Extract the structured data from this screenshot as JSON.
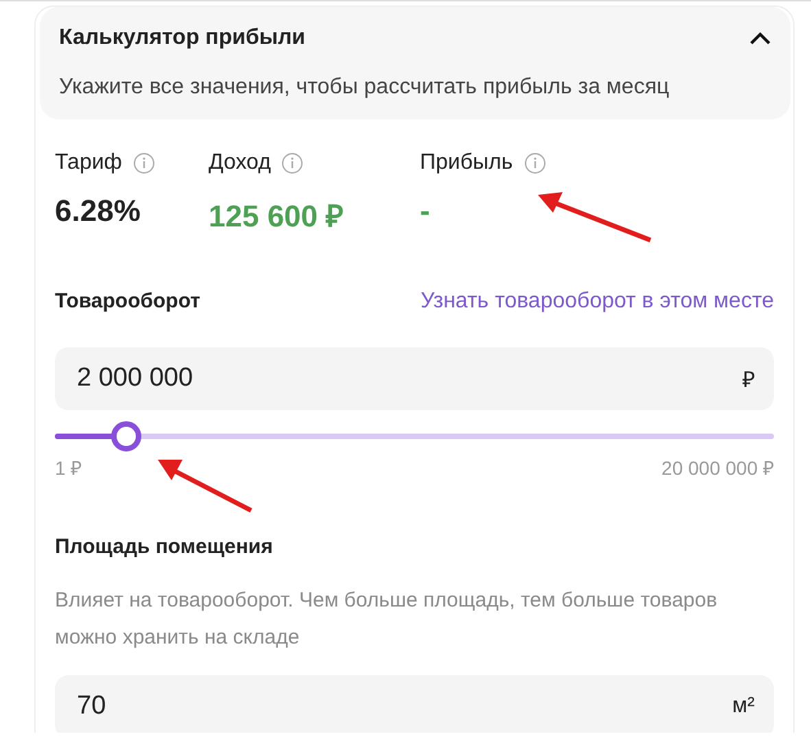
{
  "header": {
    "title": "Калькулятор прибыли",
    "expanded": true,
    "subtitle": "Укажите все значения, чтобы рассчитать прибыль за месяц"
  },
  "stats": [
    {
      "label": "Тариф",
      "value": "6.28%",
      "color": "#222222"
    },
    {
      "label": "Доход",
      "value": "125 600 ₽",
      "color": "#4ea055"
    },
    {
      "label": "Прибыль",
      "value": "-",
      "color": "#4ea055"
    }
  ],
  "turnover": {
    "label": "Товарооборот",
    "link": "Узнать товарооборот в этом месте",
    "value": "2 000 000",
    "unit": "₽",
    "level": 0.1,
    "min": "1 ₽",
    "max": "20 000 000 ₽"
  },
  "area": {
    "label": "Площадь помещения",
    "hint": "Влияет на товарооборот. Чем больше площадь, тем больше товаров можно хранить на складе",
    "value": "70",
    "unit": "м²"
  }
}
